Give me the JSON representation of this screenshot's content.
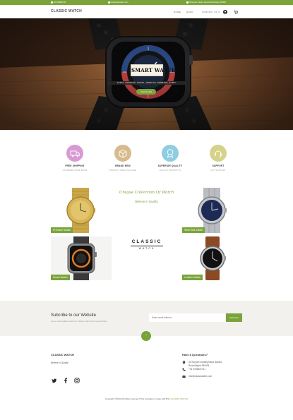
{
  "colors": {
    "accent": "#7aa33a"
  },
  "topbar": {
    "phone": "+91 9409822741",
    "email": "info@classicwatch.com",
    "address": "32 Suryam Industry Nana Mavisha Road, 360005",
    "icons": [
      "phone-icon",
      "mail-icon",
      "location-icon"
    ]
  },
  "nav": {
    "brand": "CLASSIC WATCH",
    "items": [
      "HOME",
      "SHOP",
      "CONTACT US"
    ],
    "icons": [
      "user-icon",
      "cart-icon"
    ]
  },
  "hero": {
    "title": "SMART WATCH",
    "subtitle": "APPLE, SAMSUNG, FOSSIL, ONEPLUS, REDMAGE, FITBIT",
    "button": "View Details"
  },
  "features": [
    {
      "title": "FREE SHIPPING",
      "subtitle": "ON ORDER OVER $1000",
      "icon": "truck-icon",
      "color": "#d99ad3"
    },
    {
      "title": "BRAND NEW",
      "subtitle": "PRODUCT WELL PACKAGE",
      "icon": "box-icon",
      "color": "#d8bb8d"
    },
    {
      "title": "SUPERIOR QUALITY",
      "subtitle": "QUALITY PRODUCTS",
      "icon": "award-icon",
      "color": "#8fcde0"
    },
    {
      "title": "SUPPORT",
      "subtitle": "24/7 SUPPORT",
      "icon": "support-icon",
      "color": "#d5d28c"
    }
  ],
  "collection": {
    "title": "Unique Collection Of Watch",
    "subtitle": "Believe in Quality"
  },
  "products": [
    {
      "label": "Premium Watch"
    },
    {
      "label": "Steel Belt Watch"
    },
    {
      "label": "Smart Watch"
    },
    {
      "label": "Leather Watch"
    }
  ],
  "logo": {
    "line1": "CLASSIC",
    "line2": "WATCH"
  },
  "newsletter": {
    "title": "Subcribe to our Website",
    "subtitle": "Get e-mail updates about our latest watch and special offers",
    "placeholder": "Enter email address",
    "button": "Subscribe"
  },
  "back_to_top": "⌃",
  "footer": {
    "brand": "CLASSIC WATCH",
    "tagline": "Believe in Quality",
    "questions_title": "Have a Questions?",
    "address_line1": "32 Suryam Industry,Nana Mavisa",
    "address_line2": "Road,Rajkot-360005",
    "phone": "+91 9409822741",
    "email": "info@classicwatch.com",
    "social": [
      "twitter-icon",
      "facebook-icon",
      "instagram-icon"
    ]
  },
  "copyright": {
    "prefix": "Copyright ©2023 All rights reserved | This template is made with",
    "by": "by",
    "brand": "CLASSIC WATCH"
  }
}
